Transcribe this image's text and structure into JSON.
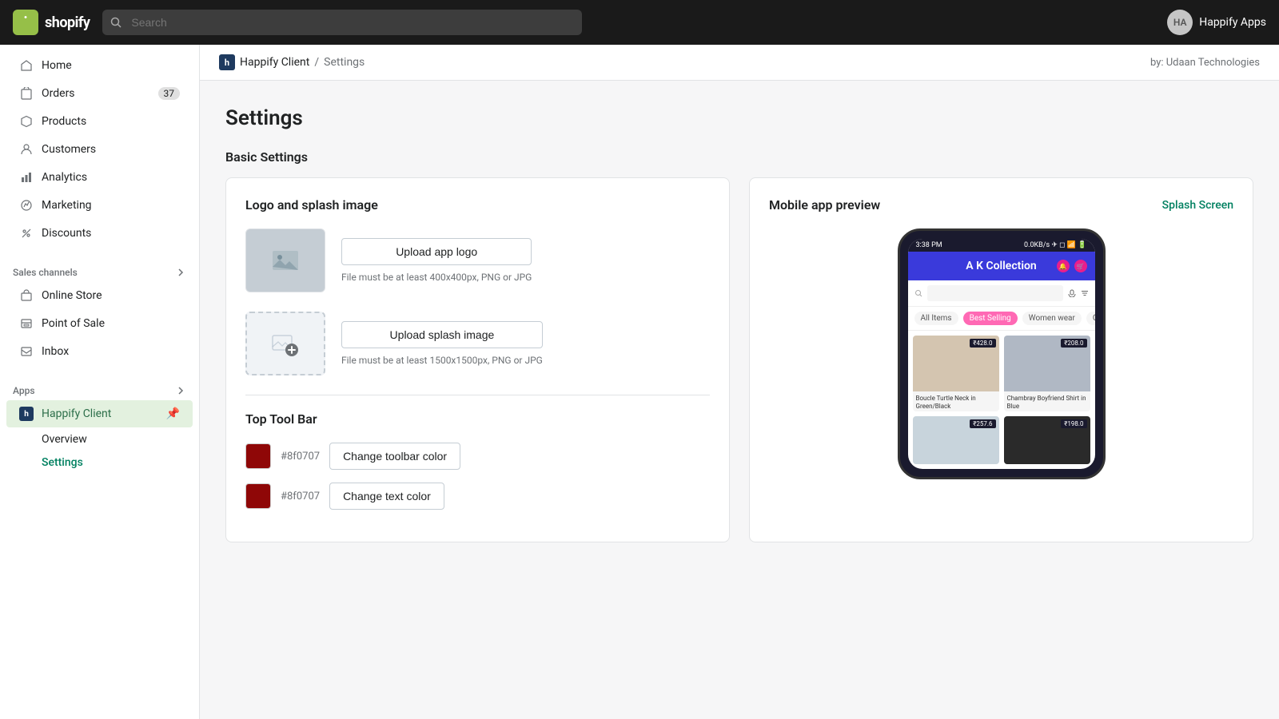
{
  "topbar": {
    "logo_text": "shopify",
    "search_placeholder": "Search",
    "user_initials": "HA",
    "user_name": "Happify Apps"
  },
  "breadcrumb": {
    "icon_text": "h",
    "app_name": "Happify Client",
    "separator": "/",
    "current_page": "Settings",
    "by_text": "by: Udaan Technologies"
  },
  "sidebar": {
    "nav_items": [
      {
        "id": "home",
        "label": "Home",
        "icon": "home"
      },
      {
        "id": "orders",
        "label": "Orders",
        "icon": "orders",
        "badge": "37"
      },
      {
        "id": "products",
        "label": "Products",
        "icon": "products"
      },
      {
        "id": "customers",
        "label": "Customers",
        "icon": "customers"
      },
      {
        "id": "analytics",
        "label": "Analytics",
        "icon": "analytics"
      },
      {
        "id": "marketing",
        "label": "Marketing",
        "icon": "marketing"
      },
      {
        "id": "discounts",
        "label": "Discounts",
        "icon": "discounts"
      }
    ],
    "sales_channels_label": "Sales channels",
    "sales_channels": [
      {
        "id": "online-store",
        "label": "Online Store",
        "icon": "store"
      },
      {
        "id": "point-of-sale",
        "label": "Point of Sale",
        "icon": "pos"
      },
      {
        "id": "inbox",
        "label": "Inbox",
        "icon": "inbox"
      }
    ],
    "apps_label": "Apps",
    "apps_item": {
      "id": "happify-client",
      "label": "Happify Client",
      "icon": "happify",
      "active": true
    },
    "sub_items": [
      {
        "id": "overview",
        "label": "Overview",
        "active": false
      },
      {
        "id": "settings",
        "label": "Settings",
        "active": true
      }
    ]
  },
  "page": {
    "title": "Settings",
    "basic_settings_label": "Basic Settings"
  },
  "logo_splash_card": {
    "title": "Logo and splash image",
    "upload_logo": {
      "button_label": "Upload app logo",
      "hint": "File must be at least 400x400px, PNG or JPG"
    },
    "upload_splash": {
      "button_label": "Upload splash image",
      "hint": "File must be at least 1500x1500px, PNG or JPG"
    }
  },
  "toolbar_card": {
    "title": "Top Tool Bar",
    "toolbar_color": {
      "hex": "#8f0707",
      "button_label": "Change toolbar color"
    },
    "text_color": {
      "hex": "#8f0707",
      "button_label": "Change text color"
    }
  },
  "preview_card": {
    "title": "Mobile app preview",
    "splash_link": "Splash Screen",
    "phone": {
      "status_bar": "3:38 PM",
      "app_name": "A K Collection",
      "tabs": [
        "All Items",
        "Best Selling",
        "Women wear",
        "Our Best"
      ],
      "active_tab": "Best Selling",
      "products": [
        {
          "price": "₹428.0",
          "name": "Boucle Turtle Neck in Green/Black"
        },
        {
          "price": "₹208.0",
          "name": "Chambray Boyfriend Shirt in Blue"
        },
        {
          "price": "₹257.6",
          "name": ""
        },
        {
          "price": "₹198.0",
          "name": ""
        }
      ]
    }
  }
}
